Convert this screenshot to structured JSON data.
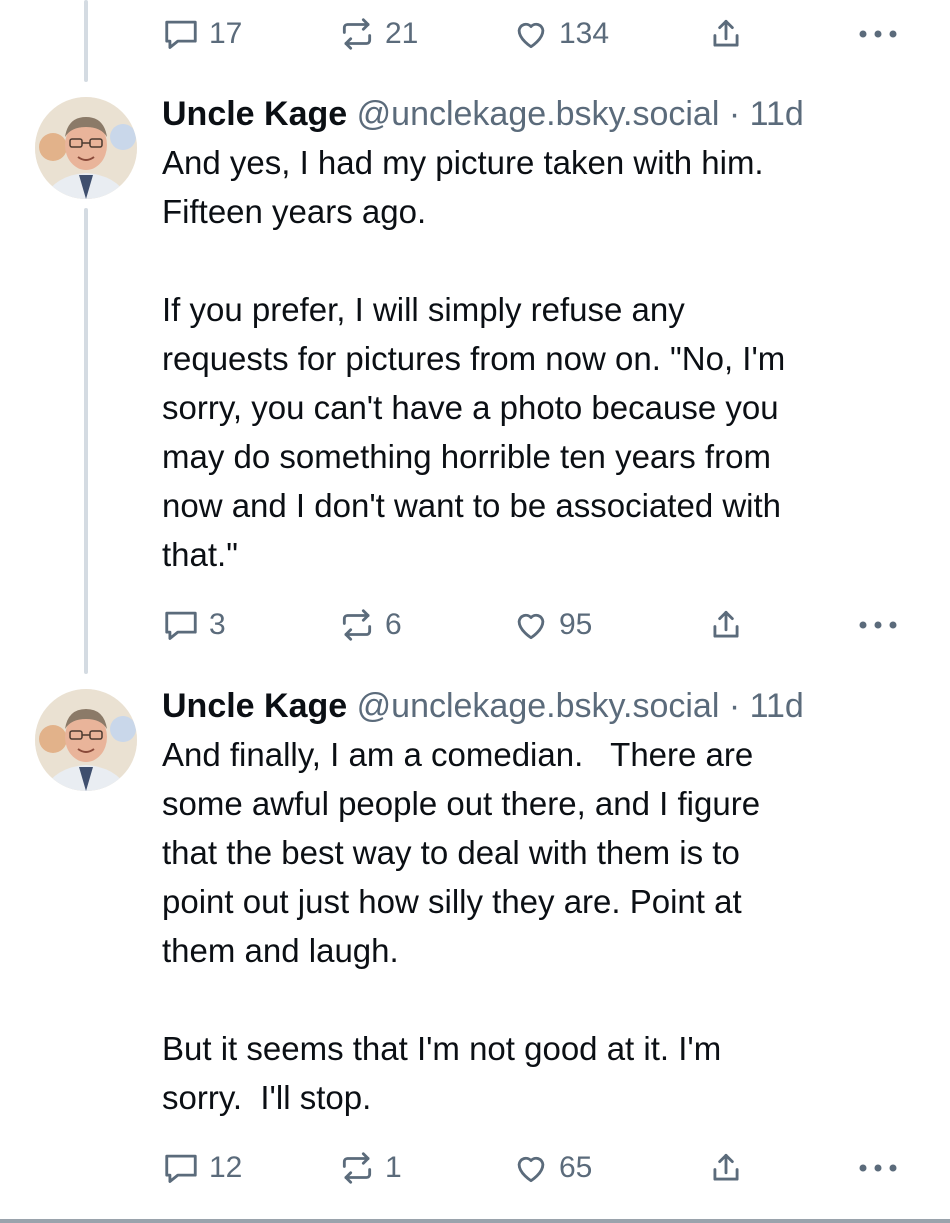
{
  "top_actions": {
    "replies": "17",
    "reposts": "21",
    "likes": "134"
  },
  "posts": [
    {
      "author": "Uncle Kage",
      "handle": "@unclekage.bsky.social",
      "separator": "·",
      "time": "11d",
      "text": "And yes, I had my picture taken with him.\nFifteen years ago.\n\nIf you prefer, I will simply refuse any\nrequests for pictures from now on. \"No, I'm\nsorry, you can't have a photo because you\nmay do something horrible ten years from\nnow and I don't want to be associated with\nthat.\"",
      "replies": "3",
      "reposts": "6",
      "likes": "95"
    },
    {
      "author": "Uncle Kage",
      "handle": "@unclekage.bsky.social",
      "separator": "·",
      "time": "11d",
      "text": "And finally, I am a comedian.   There are\nsome awful people out there, and I figure\nthat the best way to deal with them is to\npoint out just how silly they are. Point at\nthem and laugh.\n\nBut it seems that I'm not good at it. I'm\nsorry.  I'll stop.",
      "replies": "12",
      "reposts": "1",
      "likes": "65"
    }
  ],
  "icons": {
    "reply": "speech-bubble-icon",
    "repost": "repost-arrows-icon",
    "like": "heart-icon",
    "share": "share-upload-icon",
    "more": "ellipsis-icon"
  },
  "colors": {
    "text": "#0b0f14",
    "muted": "#5b6b7b",
    "thread_line": "#d4dbe2"
  }
}
